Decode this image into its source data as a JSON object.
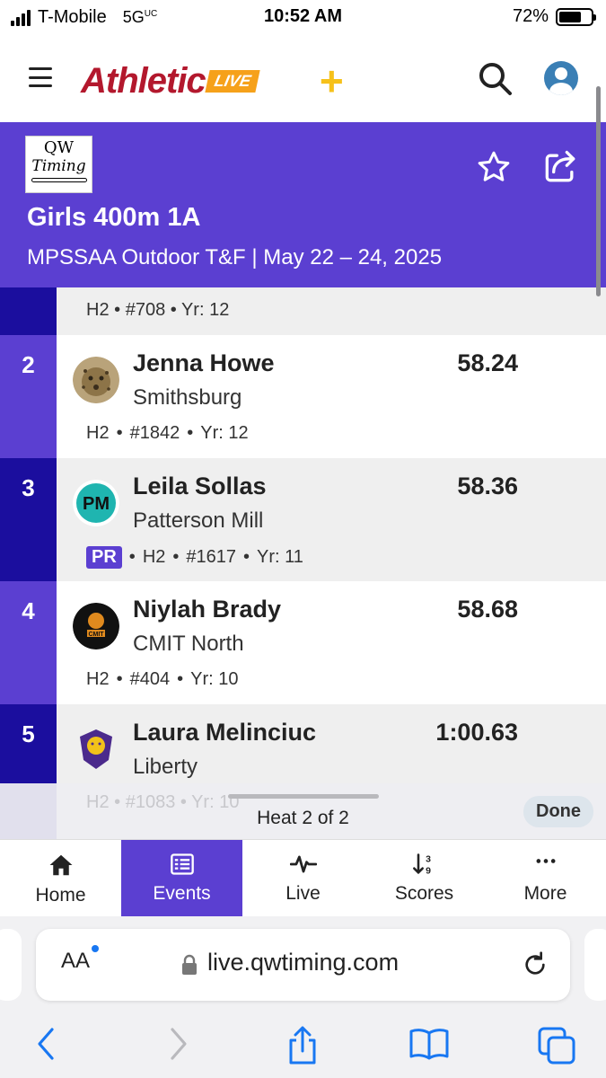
{
  "status_bar": {
    "carrier": "T-Mobile",
    "network": "5G",
    "network_suffix": "UC",
    "time": "10:52 AM",
    "battery_pct": "72%",
    "battery_level": 0.72
  },
  "header": {
    "brand_main": "Athletic",
    "brand_live": "LIVE",
    "brand_plus": "+",
    "search_icon": "search-icon",
    "account_icon": "account-icon"
  },
  "event": {
    "timer_logo_line1": "QW",
    "timer_logo_line2": "Timing",
    "title": "Girls 400m 1A",
    "subtitle": "MPSSAA Outdoor T&F | May 22 – 24, 2025"
  },
  "results": {
    "partial_prev_meta": [
      "H2",
      "#708",
      "Yr: 12"
    ],
    "rows": [
      {
        "place": "2",
        "name": "Jenna Howe",
        "team": "Smithsburg",
        "time": "58.24",
        "pr": false,
        "heat": "H2",
        "bib": "#1842",
        "year": "Yr: 12",
        "logo": "jaguar-logo"
      },
      {
        "place": "3",
        "name": "Leila Sollas",
        "team": "Patterson Mill",
        "time": "58.36",
        "pr": true,
        "pr_label": "PR",
        "heat": "H2",
        "bib": "#1617",
        "year": "Yr: 11",
        "logo": "husky-logo"
      },
      {
        "place": "4",
        "name": "Niylah Brady",
        "team": "CMIT North",
        "time": "58.68",
        "pr": false,
        "heat": "H2",
        "bib": "#404",
        "year": "Yr: 10",
        "logo": "tiger-logo"
      },
      {
        "place": "5",
        "name": "Laura Melinciuc",
        "team": "Liberty",
        "time": "1:00.63",
        "pr": false,
        "heat": "H2",
        "bib": "#1083",
        "year": "Yr: 10",
        "logo": "lion-logo"
      }
    ]
  },
  "heat_bar": {
    "label": "Heat 2 of 2",
    "done_label": "Done"
  },
  "bottom_nav": [
    {
      "label": "Home",
      "icon": "home-icon"
    },
    {
      "label": "Events",
      "icon": "list-icon",
      "active": true
    },
    {
      "label": "Live",
      "icon": "pulse-icon"
    },
    {
      "label": "Scores",
      "icon": "sort-icon"
    },
    {
      "label": "More",
      "icon": "ellipsis-icon"
    }
  ],
  "browser": {
    "text_size_label": "AA",
    "url": "live.qwtiming.com"
  },
  "colors": {
    "accent": "#5b3fd1",
    "accent_dark": "#1b0e9e",
    "row_alt": "#efefef"
  }
}
